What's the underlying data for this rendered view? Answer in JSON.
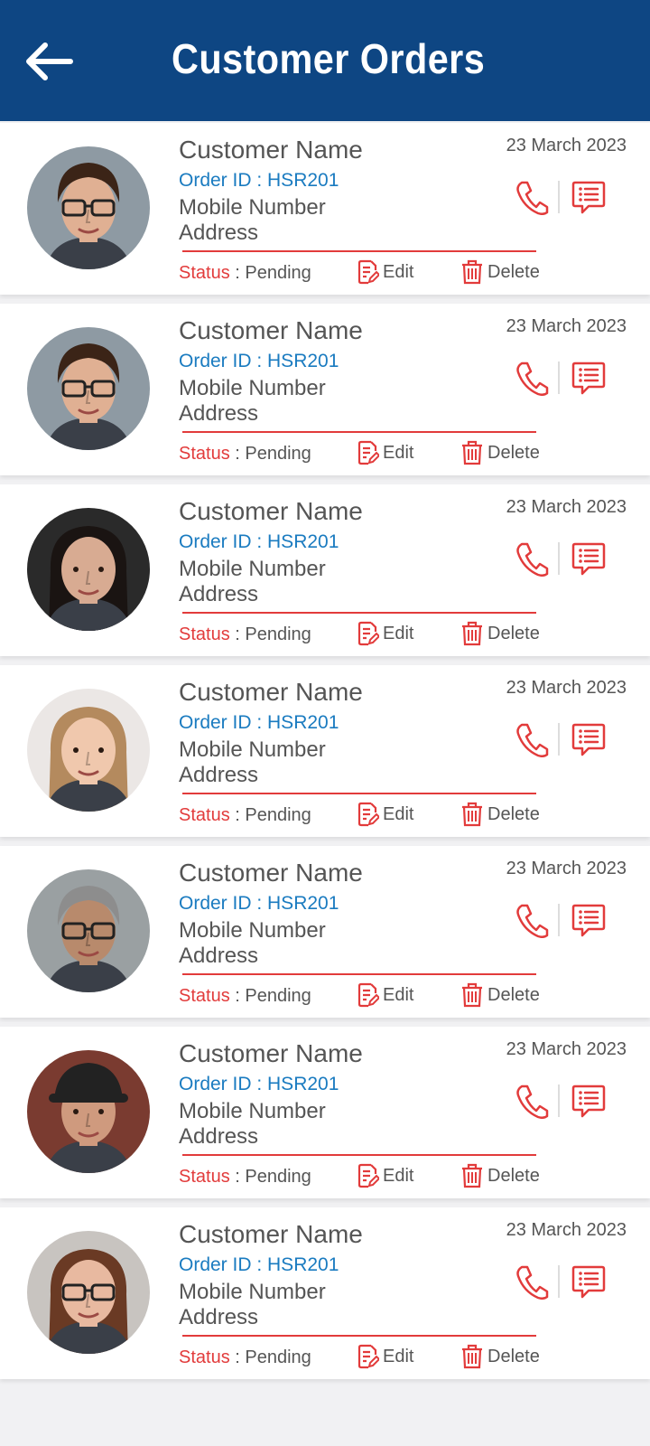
{
  "header": {
    "title": "Customer Orders",
    "back_icon": "arrow-left-icon"
  },
  "colors": {
    "header_bg": "#0e4683",
    "accent_red": "#e23b3b",
    "order_blue": "#1a7bc0",
    "text_gray": "#555555"
  },
  "orders": [
    {
      "name": "Customer Name",
      "order_label": "Order ID : HSR201",
      "mobile": "Mobile Number",
      "address": "Address",
      "date": "23 March 2023",
      "status_label": "Status",
      "status_value": " : Pending",
      "edit_label": "Edit",
      "delete_label": "Delete",
      "avatar": {
        "skin": "#e0b093",
        "hair": "#3b2417",
        "bg": "#8e9aa3",
        "glasses": true,
        "style": "short"
      }
    },
    {
      "name": "Customer Name",
      "order_label": "Order ID : HSR201",
      "mobile": "Mobile Number",
      "address": "Address",
      "date": "23 March 2023",
      "status_label": "Status",
      "status_value": " : Pending",
      "edit_label": "Edit",
      "delete_label": "Delete",
      "avatar": {
        "skin": "#e0b093",
        "hair": "#3b2417",
        "bg": "#8e9aa3",
        "glasses": true,
        "style": "short"
      }
    },
    {
      "name": "Customer Name",
      "order_label": "Order ID : HSR201",
      "mobile": "Mobile Number",
      "address": "Address",
      "date": "23 March 2023",
      "status_label": "Status",
      "status_value": " : Pending",
      "edit_label": "Edit",
      "delete_label": "Delete",
      "avatar": {
        "skin": "#d8ab92",
        "hair": "#1a1412",
        "bg": "#2a2a2a",
        "glasses": false,
        "style": "long"
      }
    },
    {
      "name": "Customer Name",
      "order_label": "Order ID : HSR201",
      "mobile": "Mobile Number",
      "address": "Address",
      "date": "23 March 2023",
      "status_label": "Status",
      "status_value": " : Pending",
      "edit_label": "Edit",
      "delete_label": "Delete",
      "avatar": {
        "skin": "#f0c8ad",
        "hair": "#b48a5e",
        "bg": "#ebe7e5",
        "glasses": false,
        "style": "long"
      }
    },
    {
      "name": "Customer Name",
      "order_label": "Order ID : HSR201",
      "mobile": "Mobile Number",
      "address": "Address",
      "date": "23 March 2023",
      "status_label": "Status",
      "status_value": " : Pending",
      "edit_label": "Edit",
      "delete_label": "Delete",
      "avatar": {
        "skin": "#b88a6c",
        "hair": "#8d8d8d",
        "bg": "#9aa0a2",
        "glasses": true,
        "style": "short"
      }
    },
    {
      "name": "Customer Name",
      "order_label": "Order ID : HSR201",
      "mobile": "Mobile Number",
      "address": "Address",
      "date": "23 March 2023",
      "status_label": "Status",
      "status_value": " : Pending",
      "edit_label": "Edit",
      "delete_label": "Delete",
      "avatar": {
        "skin": "#cf9a7e",
        "hair": "#222222",
        "bg": "#7a3b30",
        "glasses": false,
        "style": "cap"
      }
    },
    {
      "name": "Customer Name",
      "order_label": "Order ID : HSR201",
      "mobile": "Mobile Number",
      "address": "Address",
      "date": "23 March 2023",
      "status_label": "Status",
      "status_value": " : Pending",
      "edit_label": "Edit",
      "delete_label": "Delete",
      "avatar": {
        "skin": "#e8b9a0",
        "hair": "#6a3a24",
        "bg": "#c8c4c0",
        "glasses": true,
        "style": "long"
      }
    }
  ]
}
